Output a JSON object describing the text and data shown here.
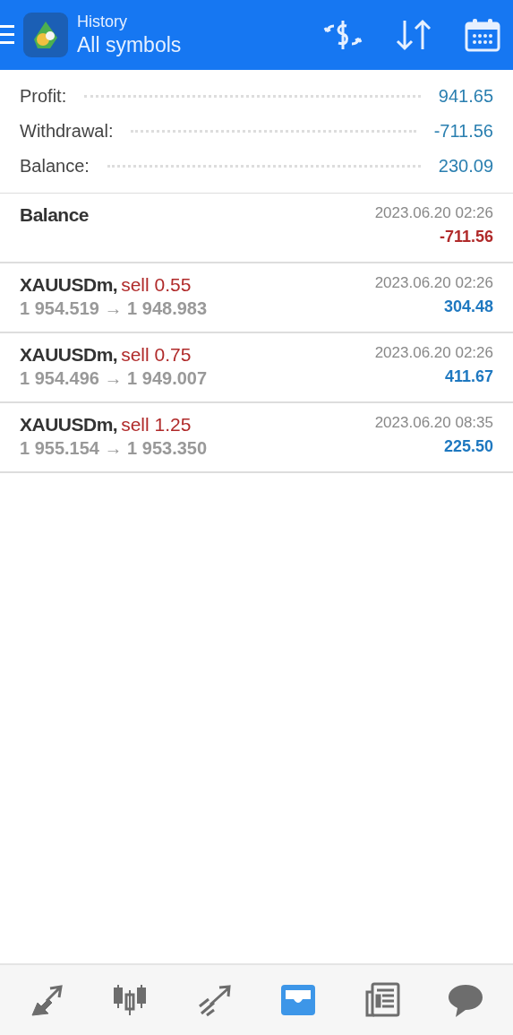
{
  "header": {
    "title": "History",
    "subtitle": "All symbols"
  },
  "summary": [
    {
      "label": "Profit:",
      "value": "941.65"
    },
    {
      "label": "Withdrawal:",
      "value": "-711.56"
    },
    {
      "label": "Balance:",
      "value": "230.09"
    }
  ],
  "deals": [
    {
      "kind": "balance",
      "title": "Balance",
      "time": "2023.06.20 02:26",
      "amount": "-711.56",
      "loss": true
    },
    {
      "kind": "trade",
      "symbol": "XAUUSDm,",
      "side": "sell 0.55",
      "prices": "1 954.519 → 1 948.983",
      "time": "2023.06.20 02:26",
      "amount": "304.48",
      "loss": false
    },
    {
      "kind": "trade",
      "symbol": "XAUUSDm,",
      "side": "sell 0.75",
      "prices": "1 954.496 → 1 949.007",
      "time": "2023.06.20 02:26",
      "amount": "411.67",
      "loss": false
    },
    {
      "kind": "trade",
      "symbol": "XAUUSDm,",
      "side": "sell 1.25",
      "prices": "1 955.154 → 1 953.350",
      "time": "2023.06.20 08:35",
      "amount": "225.50",
      "loss": false
    }
  ],
  "nav": [
    {
      "kind": "quotes",
      "selected": false
    },
    {
      "kind": "chart",
      "selected": false
    },
    {
      "kind": "trade",
      "selected": false
    },
    {
      "kind": "history",
      "selected": true
    },
    {
      "kind": "news",
      "selected": false
    },
    {
      "kind": "chat",
      "selected": false
    }
  ]
}
